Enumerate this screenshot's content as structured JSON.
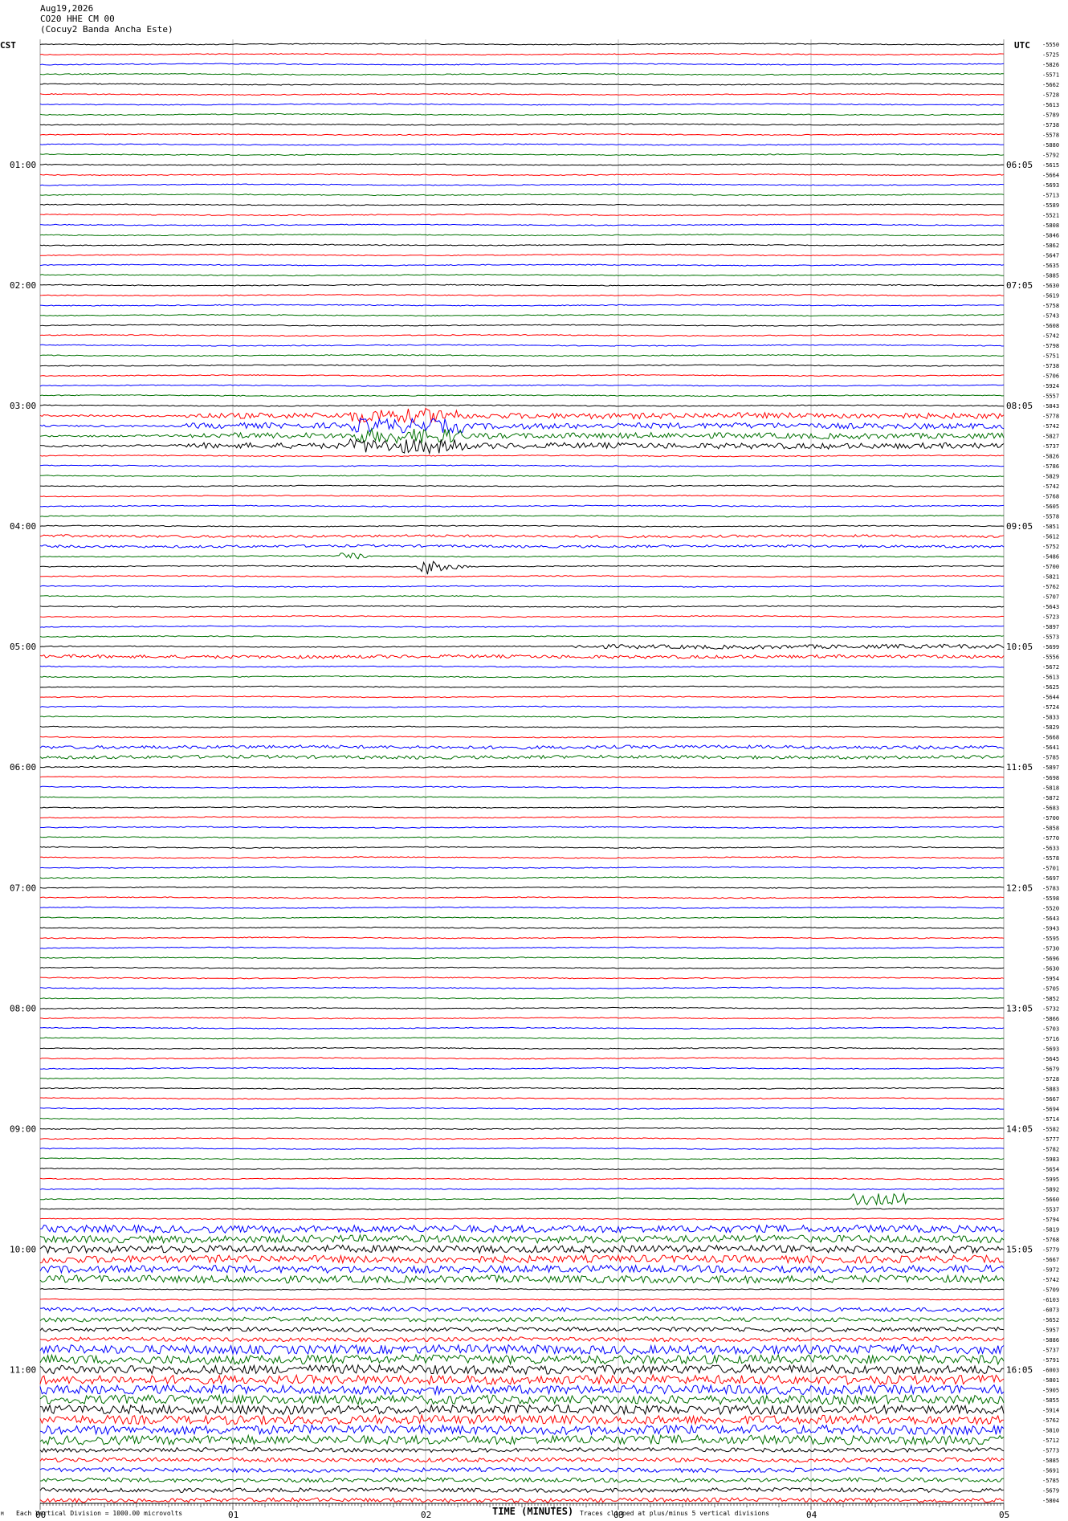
{
  "header": {
    "date": "Aug19,2026",
    "station": "CO20 HHE CM 00",
    "name": "(Cocuy2 Banda Ancha Este)"
  },
  "chart_data": {
    "type": "line",
    "left_axis_label": "CST",
    "right_axis_label": "UTC",
    "xlabel": "TIME (MINUTES)",
    "x_ticks": [
      "00",
      "01",
      "02",
      "03",
      "04",
      "05"
    ],
    "xlim": [
      0,
      5
    ],
    "left_time_labels": [
      "01:00",
      "02:00",
      "03:00",
      "04:00",
      "05:00",
      "06:00",
      "07:00",
      "08:00",
      "09:00",
      "10:00",
      "11:00"
    ],
    "right_time_labels": [
      "06:05",
      "07:05",
      "08:05",
      "09:05",
      "10:05",
      "11:05",
      "12:05",
      "13:05",
      "14:05",
      "15:05",
      "16:05"
    ],
    "traces_per_hour": 12,
    "trace_colors": [
      "#000000",
      "#ff0000",
      "#0000ff",
      "#007000"
    ],
    "right_values": [
      "-5550",
      "-5725",
      "-5826",
      "-5571",
      "-5662",
      "-5728",
      "-5613",
      "-5789",
      "-5738",
      "-5578",
      "-5880",
      "-5792",
      "-5615",
      "-5664",
      "-5693",
      "-5713",
      "-5589",
      "-5521",
      "-5808",
      "-5846",
      "-5862",
      "-5647",
      "-5635",
      "-5885",
      "-5630",
      "-5619",
      "-5758",
      "-5743",
      "-5608",
      "-5742",
      "-5798",
      "-5751",
      "-5738",
      "-5706",
      "-5924",
      "-5557",
      "-5843",
      "-5778",
      "-5742",
      "-5827",
      "-5737",
      "-5826",
      "-5786",
      "-5829",
      "-5742",
      "-5768",
      "-5605",
      "-5578",
      "-5851",
      "-5612",
      "-5752",
      "-5486",
      "-5700",
      "-5821",
      "-5762",
      "-5707",
      "-5643",
      "-5723",
      "-5897",
      "-5573",
      "-5699",
      "-5556",
      "-5672",
      "-5613",
      "-5625",
      "-5644",
      "-5724",
      "-5833",
      "-5829",
      "-5668",
      "-5641",
      "-5785",
      "-5897",
      "-5698",
      "-5818",
      "-5872",
      "-5683",
      "-5700",
      "-5858",
      "-5770",
      "-5633",
      "-5578",
      "-5701",
      "-5697",
      "-5783",
      "-5598",
      "-5520",
      "-5643",
      "-5943",
      "-5595",
      "-5730",
      "-5696",
      "-5630",
      "-5954",
      "-5705",
      "-5852",
      "-5732",
      "-5866",
      "-5703",
      "-5716",
      "-5693",
      "-5645",
      "-5679",
      "-5728",
      "-5883",
      "-5667",
      "-5694",
      "-5714",
      "-5582",
      "-5777",
      "-5782",
      "-5983",
      "-5654",
      "-5995",
      "-5892",
      "-5660",
      "-5537",
      "-5794",
      "-5819",
      "-5768",
      "-5779",
      "-5667",
      "-5972",
      "-5742",
      "-5709",
      "-6103",
      "-6073",
      "-5652",
      "-5957",
      "-5886",
      "-5737",
      "-5791",
      "-6003",
      "-5801",
      "-5905",
      "-5855",
      "-5914",
      "-5762",
      "-5810",
      "-5712",
      "-5773",
      "-5885",
      "-5691",
      "-5785",
      "-5679",
      "-5804"
    ],
    "footer_left": "Each Vertical Division = 1000.00 microvolts",
    "footer_right": "Traces clipped at plus/minus 5 vertical divisions",
    "corner_mark": "M"
  }
}
